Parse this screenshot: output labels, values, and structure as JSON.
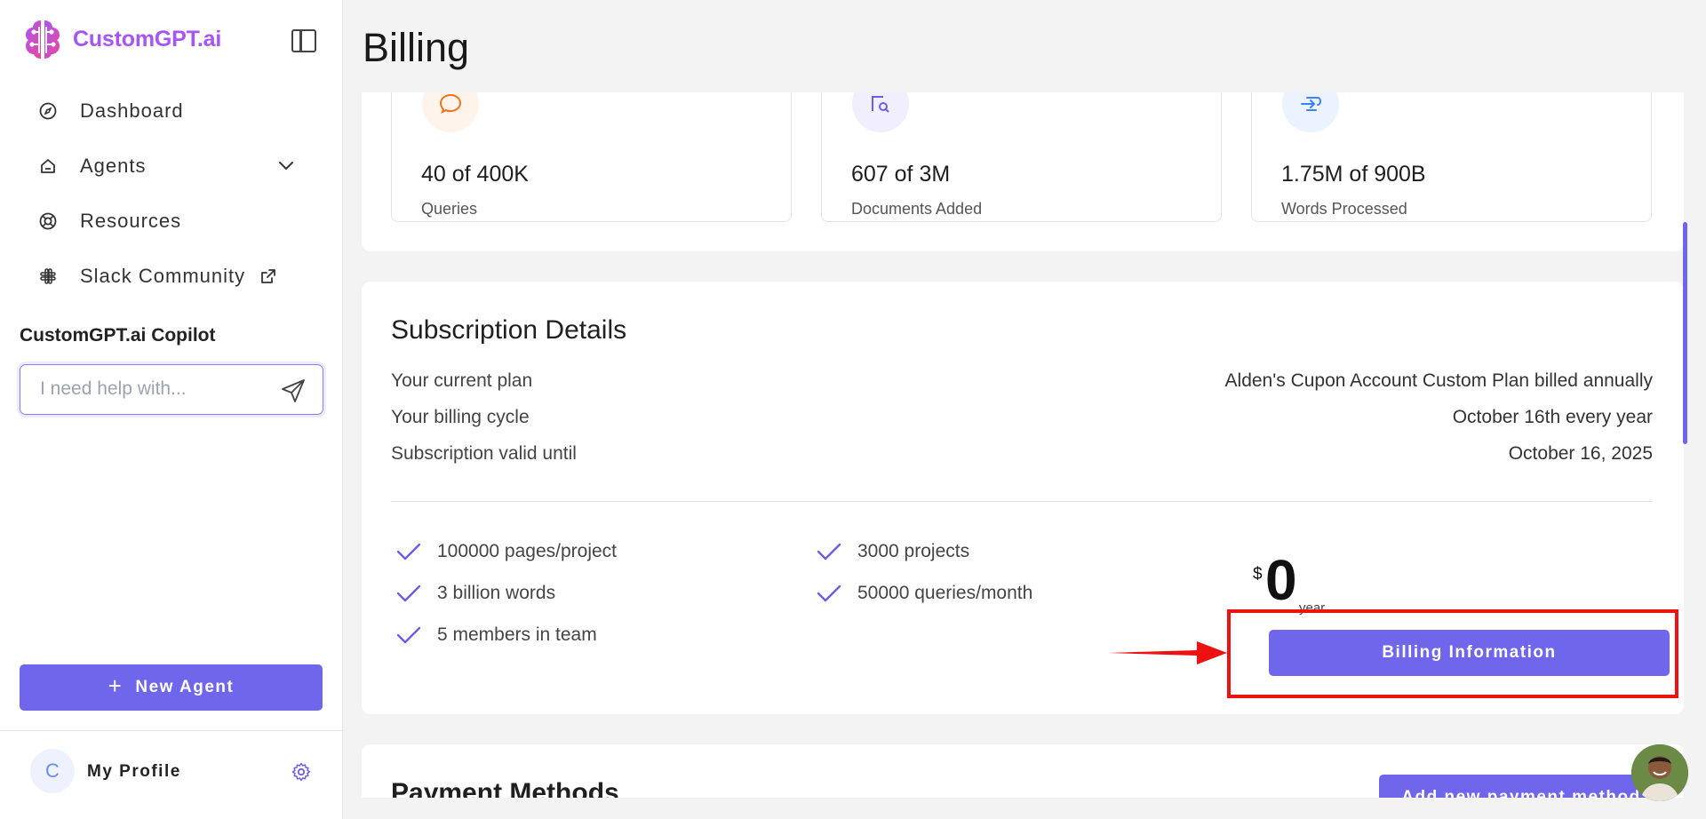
{
  "brand": {
    "name": "CustomGPT.ai"
  },
  "sidebar": {
    "items": [
      {
        "label": "Dashboard",
        "icon": "compass-icon"
      },
      {
        "label": "Agents",
        "icon": "home-icon"
      },
      {
        "label": "Resources",
        "icon": "lifebuoy-icon"
      },
      {
        "label": "Slack Community",
        "icon": "slack-icon"
      }
    ],
    "copilot_title": "CustomGPT.ai Copilot",
    "copilot_placeholder": "I need help with...",
    "new_agent_label": "New Agent",
    "profile_initial": "C",
    "profile_name": "My Profile"
  },
  "page": {
    "title": "Billing"
  },
  "stats": [
    {
      "value": "40 of 400K",
      "label": "Queries",
      "icon": "chat-bubble-icon",
      "color": "#f97316"
    },
    {
      "value": "607 of 3M",
      "label": "Documents Added",
      "icon": "document-search-icon",
      "color": "#6d5ce8"
    },
    {
      "value": "1.75M of 900B",
      "label": "Words Processed",
      "icon": "words-icon",
      "color": "#3b82f6"
    }
  ],
  "subscription": {
    "title": "Subscription Details",
    "rows": [
      {
        "label": "Your current plan",
        "value": "Alden's Cupon Account Custom Plan billed annually"
      },
      {
        "label": "Your billing cycle",
        "value": "October 16th every year"
      },
      {
        "label": "Subscription valid until",
        "value": "October 16, 2025"
      }
    ],
    "features": [
      "100000 pages/project",
      "3000 projects",
      "3 billion words",
      "50000 queries/month",
      "5 members in team"
    ],
    "price_currency": "$",
    "price_amount": "0",
    "price_period": "year",
    "billing_button": "Billing Information"
  },
  "payment": {
    "title": "Payment Methods",
    "add_button": "Add new payment method"
  },
  "colors": {
    "accent": "#7066ec",
    "brand": "#a855f7",
    "highlight": "#ee1111"
  }
}
